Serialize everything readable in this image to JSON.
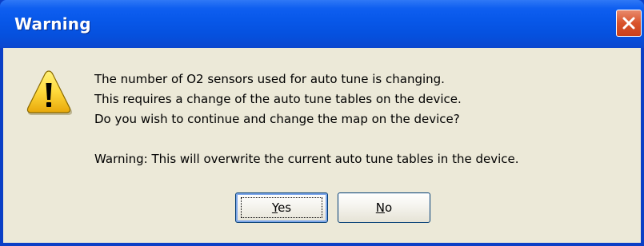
{
  "window": {
    "title": "Warning"
  },
  "message": {
    "lines": [
      "The number of O2 sensors used for auto tune is changing.",
      "This requires a change of the auto tune tables on the device.",
      "Do you wish to continue and change the map on the device?"
    ],
    "warning": "Warning: This will overwrite the current auto tune tables in the device."
  },
  "buttons": {
    "yes_mnemonic": "Y",
    "yes_rest": "es",
    "no_mnemonic": "N",
    "no_rest": "o"
  },
  "icons": {
    "dialog_icon": "warning-icon",
    "close_icon": "close-icon"
  },
  "colors": {
    "title_bar": "#0757e8",
    "client_bg": "#ece9d8",
    "close_button": "#d9532c",
    "warning_yellow": "#ffd93b"
  }
}
